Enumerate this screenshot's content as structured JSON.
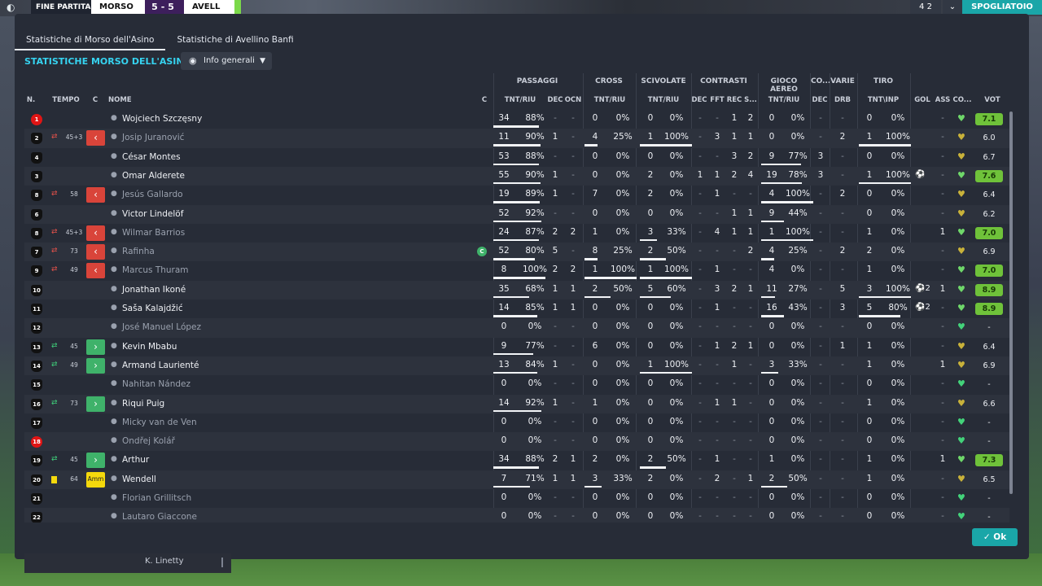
{
  "topbar": {
    "status": "FINE PARTITA",
    "team1": "MORSO",
    "score": "5-5",
    "team2": "AVELL",
    "count": "4 2",
    "dressing_room": "SPOGLIATOIO"
  },
  "tabs": [
    {
      "label": "Statistiche di Morso dell'Asino",
      "active": true
    },
    {
      "label": "Statistiche di Avellino Banfi",
      "active": false
    }
  ],
  "page_title": "STATISTICHE MORSO DELL'ASINO",
  "view_dropdown": {
    "value": "Info generali",
    "icon": "eye-icon"
  },
  "groups": [
    "PASSAGGI",
    "CROSS",
    "SCIVOLATE",
    "CONTRASTI",
    "GIOCO AEREO",
    "CO...",
    "VARIE",
    "TIRO"
  ],
  "headers": {
    "num": "N.",
    "tempo": "TEMPO",
    "c": "C",
    "nome": "NOME",
    "c2": "C",
    "pass_tnt": "TNT/RIU",
    "pass_dec": "DEC",
    "pass_ocn": "OCN",
    "cross_tnt": "TNT/RIU",
    "scivolate_tnt": "TNT/RIU",
    "contrasti_dec": "DEC",
    "contrasti_fft": "FFT",
    "contrasti_rec": "REC",
    "contrasti_s": "S...",
    "aereo_tnt": "TNT/RIU",
    "co_dec": "DEC",
    "varie_drb": "DRB",
    "tiro_tnt": "TNT\\INP",
    "gol": "GOL",
    "ass": "ASS",
    "co": "CO...",
    "vot": "VOT"
  },
  "players": [
    {
      "num": "1",
      "gk": true,
      "minute": "",
      "sub": "",
      "name": "Wojciech Szczęsny",
      "dim": false,
      "captain": false,
      "pt": "34",
      "pp": "88%",
      "pbar": 0.88,
      "pdec": "-",
      "pocn": "-",
      "ct": "0",
      "cp": "0%",
      "cbar": 0,
      "st": "0",
      "sp": "0%",
      "sbar": 0,
      "kdec": "-",
      "kfft": "-",
      "krec": "1",
      "ks": "2",
      "at": "0",
      "ap": "0%",
      "abar": 0,
      "codec": "-",
      "drb": "-",
      "tt": "0",
      "tp": "0%",
      "tbar": 0,
      "gol": "",
      "ass": "-",
      "vote": "7.1",
      "hi": true
    },
    {
      "num": "2",
      "gk": false,
      "minute": "45+3",
      "sub": "out",
      "name": "Josip Juranović",
      "dim": true,
      "captain": false,
      "pt": "11",
      "pp": "90%",
      "pbar": 0.9,
      "pdec": "1",
      "pocn": "-",
      "ct": "4",
      "cp": "25%",
      "cbar": 0.25,
      "st": "1",
      "sp": "100%",
      "sbar": 1,
      "kdec": "-",
      "kfft": "3",
      "krec": "1",
      "ks": "1",
      "at": "0",
      "ap": "0%",
      "abar": 0,
      "codec": "-",
      "drb": "2",
      "tt": "1",
      "tp": "100%",
      "tbar": 1,
      "gol": "",
      "ass": "-",
      "vote": "6.0",
      "hi": false
    },
    {
      "num": "4",
      "gk": false,
      "minute": "",
      "sub": "",
      "name": "César Montes",
      "dim": false,
      "captain": false,
      "pt": "53",
      "pp": "88%",
      "pbar": 0.88,
      "pdec": "-",
      "pocn": "-",
      "ct": "0",
      "cp": "0%",
      "cbar": 0,
      "st": "0",
      "sp": "0%",
      "sbar": 0,
      "kdec": "-",
      "kfft": "-",
      "krec": "3",
      "ks": "2",
      "at": "9",
      "ap": "77%",
      "abar": 0.77,
      "codec": "3",
      "drb": "-",
      "tt": "0",
      "tp": "0%",
      "tbar": 0,
      "gol": "",
      "ass": "-",
      "vote": "6.7",
      "hi": false
    },
    {
      "num": "3",
      "gk": false,
      "minute": "",
      "sub": "",
      "name": "Omar Alderete",
      "dim": false,
      "captain": false,
      "pt": "55",
      "pp": "90%",
      "pbar": 0.9,
      "pdec": "1",
      "pocn": "-",
      "ct": "0",
      "cp": "0%",
      "cbar": 0,
      "st": "2",
      "sp": "0%",
      "sbar": 0,
      "kdec": "1",
      "kfft": "1",
      "krec": "2",
      "ks": "4",
      "at": "19",
      "ap": "78%",
      "abar": 0.78,
      "codec": "3",
      "drb": "-",
      "tt": "1",
      "tp": "100%",
      "tbar": 1,
      "gol": "⚽",
      "ass": "-",
      "vote": "7.6",
      "hi": true
    },
    {
      "num": "8",
      "gk": false,
      "minute": "58",
      "sub": "out",
      "name": "Jesús Gallardo",
      "dim": true,
      "captain": false,
      "pt": "19",
      "pp": "89%",
      "pbar": 0.89,
      "pdec": "1",
      "pocn": "-",
      "ct": "7",
      "cp": "0%",
      "cbar": 0,
      "st": "2",
      "sp": "0%",
      "sbar": 0,
      "kdec": "-",
      "kfft": "1",
      "krec": "-",
      "ks": "-",
      "at": "4",
      "ap": "100%",
      "abar": 1,
      "codec": "-",
      "drb": "2",
      "tt": "0",
      "tp": "0%",
      "tbar": 0,
      "gol": "",
      "ass": "-",
      "vote": "6.4",
      "hi": false
    },
    {
      "num": "6",
      "gk": false,
      "minute": "",
      "sub": "",
      "name": "Victor Lindelöf",
      "dim": false,
      "captain": false,
      "pt": "52",
      "pp": "92%",
      "pbar": 0.92,
      "pdec": "-",
      "pocn": "-",
      "ct": "0",
      "cp": "0%",
      "cbar": 0,
      "st": "0",
      "sp": "0%",
      "sbar": 0,
      "kdec": "-",
      "kfft": "-",
      "krec": "1",
      "ks": "1",
      "at": "9",
      "ap": "44%",
      "abar": 0.44,
      "codec": "-",
      "drb": "-",
      "tt": "0",
      "tp": "0%",
      "tbar": 0,
      "gol": "",
      "ass": "-",
      "vote": "6.2",
      "hi": false
    },
    {
      "num": "8",
      "gk": false,
      "minute": "45+3",
      "sub": "out",
      "name": "Wilmar Barrios",
      "dim": true,
      "captain": false,
      "pt": "24",
      "pp": "87%",
      "pbar": 0.87,
      "pdec": "2",
      "pocn": "2",
      "ct": "1",
      "cp": "0%",
      "cbar": 0,
      "st": "3",
      "sp": "33%",
      "sbar": 0.33,
      "kdec": "-",
      "kfft": "4",
      "krec": "1",
      "ks": "1",
      "at": "1",
      "ap": "100%",
      "abar": 1,
      "codec": "-",
      "drb": "-",
      "tt": "1",
      "tp": "0%",
      "tbar": 0,
      "gol": "",
      "ass": "1",
      "vote": "7.0",
      "hi": true
    },
    {
      "num": "7",
      "gk": false,
      "minute": "73",
      "sub": "out",
      "name": "Rafinha",
      "dim": true,
      "captain": true,
      "pt": "52",
      "pp": "80%",
      "pbar": 0.8,
      "pdec": "5",
      "pocn": "-",
      "ct": "8",
      "cp": "25%",
      "cbar": 0.25,
      "st": "2",
      "sp": "50%",
      "sbar": 0.5,
      "kdec": "-",
      "kfft": "-",
      "krec": "-",
      "ks": "2",
      "at": "4",
      "ap": "25%",
      "abar": 0.25,
      "codec": "-",
      "drb": "2",
      "tt": "2",
      "tp": "0%",
      "tbar": 0,
      "gol": "",
      "ass": "-",
      "vote": "6.9",
      "hi": false
    },
    {
      "num": "9",
      "gk": false,
      "minute": "49",
      "sub": "out",
      "name": "Marcus Thuram",
      "dim": true,
      "captain": false,
      "pt": "8",
      "pp": "100%",
      "pbar": 1,
      "pdec": "2",
      "pocn": "2",
      "ct": "1",
      "cp": "100%",
      "cbar": 1,
      "st": "1",
      "sp": "100%",
      "sbar": 1,
      "kdec": "-",
      "kfft": "1",
      "krec": "-",
      "ks": "-",
      "at": "4",
      "ap": "0%",
      "abar": 0,
      "codec": "-",
      "drb": "-",
      "tt": "1",
      "tp": "0%",
      "tbar": 0,
      "gol": "",
      "ass": "-",
      "vote": "7.0",
      "hi": true
    },
    {
      "num": "10",
      "gk": false,
      "minute": "",
      "sub": "",
      "name": "Jonathan Ikoné",
      "dim": false,
      "captain": false,
      "pt": "35",
      "pp": "68%",
      "pbar": 0.68,
      "pdec": "1",
      "pocn": "1",
      "ct": "2",
      "cp": "50%",
      "cbar": 0.5,
      "st": "5",
      "sp": "60%",
      "sbar": 0.6,
      "kdec": "-",
      "kfft": "3",
      "krec": "2",
      "ks": "1",
      "at": "11",
      "ap": "27%",
      "abar": 0.27,
      "codec": "-",
      "drb": "5",
      "tt": "3",
      "tp": "100%",
      "tbar": 1,
      "gol": "⚽2",
      "ass": "1",
      "vote": "8.9",
      "hi": true
    },
    {
      "num": "11",
      "gk": false,
      "minute": "",
      "sub": "",
      "name": "Saša Kalajdžić",
      "dim": false,
      "captain": false,
      "pt": "14",
      "pp": "85%",
      "pbar": 0.85,
      "pdec": "1",
      "pocn": "1",
      "ct": "0",
      "cp": "0%",
      "cbar": 0,
      "st": "0",
      "sp": "0%",
      "sbar": 0,
      "kdec": "-",
      "kfft": "1",
      "krec": "-",
      "ks": "-",
      "at": "16",
      "ap": "43%",
      "abar": 0.43,
      "codec": "-",
      "drb": "3",
      "tt": "5",
      "tp": "80%",
      "tbar": 0.8,
      "gol": "⚽2",
      "ass": "-",
      "vote": "8.9",
      "hi": true
    },
    {
      "num": "12",
      "gk": false,
      "minute": "",
      "sub": "",
      "name": "José Manuel López",
      "dim": true,
      "captain": false,
      "pt": "0",
      "pp": "0%",
      "pbar": 0,
      "pdec": "-",
      "pocn": "-",
      "ct": "0",
      "cp": "0%",
      "cbar": 0,
      "st": "0",
      "sp": "0%",
      "sbar": 0,
      "kdec": "-",
      "kfft": "-",
      "krec": "-",
      "ks": "-",
      "at": "0",
      "ap": "0%",
      "abar": 0,
      "codec": "-",
      "drb": "-",
      "tt": "0",
      "tp": "0%",
      "tbar": 0,
      "gol": "",
      "ass": "-",
      "vote": "-",
      "hi": false
    },
    {
      "num": "13",
      "gk": false,
      "minute": "45",
      "sub": "in",
      "name": "Kevin Mbabu",
      "dim": false,
      "captain": false,
      "pt": "9",
      "pp": "77%",
      "pbar": 0.77,
      "pdec": "-",
      "pocn": "-",
      "ct": "6",
      "cp": "0%",
      "cbar": 0,
      "st": "0",
      "sp": "0%",
      "sbar": 0,
      "kdec": "-",
      "kfft": "1",
      "krec": "2",
      "ks": "1",
      "at": "0",
      "ap": "0%",
      "abar": 0,
      "codec": "-",
      "drb": "1",
      "tt": "1",
      "tp": "0%",
      "tbar": 0,
      "gol": "",
      "ass": "-",
      "vote": "6.4",
      "hi": false
    },
    {
      "num": "14",
      "gk": false,
      "minute": "49",
      "sub": "in",
      "name": "Armand Laurienté",
      "dim": false,
      "captain": false,
      "pt": "13",
      "pp": "84%",
      "pbar": 0.84,
      "pdec": "1",
      "pocn": "-",
      "ct": "0",
      "cp": "0%",
      "cbar": 0,
      "st": "1",
      "sp": "100%",
      "sbar": 1,
      "kdec": "-",
      "kfft": "-",
      "krec": "1",
      "ks": "-",
      "at": "3",
      "ap": "33%",
      "abar": 0.33,
      "codec": "-",
      "drb": "-",
      "tt": "1",
      "tp": "0%",
      "tbar": 0,
      "gol": "",
      "ass": "1",
      "vote": "6.9",
      "hi": false
    },
    {
      "num": "15",
      "gk": false,
      "minute": "",
      "sub": "",
      "name": "Nahitan Nández",
      "dim": true,
      "captain": false,
      "pt": "0",
      "pp": "0%",
      "pbar": 0,
      "pdec": "-",
      "pocn": "-",
      "ct": "0",
      "cp": "0%",
      "cbar": 0,
      "st": "0",
      "sp": "0%",
      "sbar": 0,
      "kdec": "-",
      "kfft": "-",
      "krec": "-",
      "ks": "-",
      "at": "0",
      "ap": "0%",
      "abar": 0,
      "codec": "-",
      "drb": "-",
      "tt": "0",
      "tp": "0%",
      "tbar": 0,
      "gol": "",
      "ass": "-",
      "vote": "-",
      "hi": false
    },
    {
      "num": "16",
      "gk": false,
      "minute": "73",
      "sub": "in",
      "name": "Riqui Puig",
      "dim": false,
      "captain": false,
      "pt": "14",
      "pp": "92%",
      "pbar": 0.92,
      "pdec": "1",
      "pocn": "-",
      "ct": "1",
      "cp": "0%",
      "cbar": 0,
      "st": "0",
      "sp": "0%",
      "sbar": 0,
      "kdec": "-",
      "kfft": "1",
      "krec": "1",
      "ks": "-",
      "at": "0",
      "ap": "0%",
      "abar": 0,
      "codec": "-",
      "drb": "-",
      "tt": "1",
      "tp": "0%",
      "tbar": 0,
      "gol": "",
      "ass": "-",
      "vote": "6.6",
      "hi": false
    },
    {
      "num": "17",
      "gk": false,
      "minute": "",
      "sub": "",
      "name": "Micky van de Ven",
      "dim": true,
      "captain": false,
      "pt": "0",
      "pp": "0%",
      "pbar": 0,
      "pdec": "-",
      "pocn": "-",
      "ct": "0",
      "cp": "0%",
      "cbar": 0,
      "st": "0",
      "sp": "0%",
      "sbar": 0,
      "kdec": "-",
      "kfft": "-",
      "krec": "-",
      "ks": "-",
      "at": "0",
      "ap": "0%",
      "abar": 0,
      "codec": "-",
      "drb": "-",
      "tt": "0",
      "tp": "0%",
      "tbar": 0,
      "gol": "",
      "ass": "-",
      "vote": "-",
      "hi": false
    },
    {
      "num": "18",
      "gk": true,
      "minute": "",
      "sub": "",
      "name": "Ondřej Kolář",
      "dim": true,
      "captain": false,
      "pt": "0",
      "pp": "0%",
      "pbar": 0,
      "pdec": "-",
      "pocn": "-",
      "ct": "0",
      "cp": "0%",
      "cbar": 0,
      "st": "0",
      "sp": "0%",
      "sbar": 0,
      "kdec": "-",
      "kfft": "-",
      "krec": "-",
      "ks": "-",
      "at": "0",
      "ap": "0%",
      "abar": 0,
      "codec": "-",
      "drb": "-",
      "tt": "0",
      "tp": "0%",
      "tbar": 0,
      "gol": "",
      "ass": "-",
      "vote": "-",
      "hi": false
    },
    {
      "num": "19",
      "gk": false,
      "minute": "45",
      "sub": "in",
      "name": "Arthur",
      "dim": false,
      "captain": false,
      "pt": "34",
      "pp": "88%",
      "pbar": 0.88,
      "pdec": "2",
      "pocn": "1",
      "ct": "2",
      "cp": "0%",
      "cbar": 0,
      "st": "2",
      "sp": "50%",
      "sbar": 0.5,
      "kdec": "-",
      "kfft": "1",
      "krec": "-",
      "ks": "-",
      "at": "1",
      "ap": "0%",
      "abar": 0,
      "codec": "-",
      "drb": "-",
      "tt": "1",
      "tp": "0%",
      "tbar": 0,
      "gol": "",
      "ass": "1",
      "vote": "7.3",
      "hi": true
    },
    {
      "num": "20",
      "gk": false,
      "minute": "64",
      "sub": "amm",
      "yellow": true,
      "name": "Wendell",
      "dim": false,
      "captain": false,
      "pt": "7",
      "pp": "71%",
      "pbar": 0.71,
      "pdec": "1",
      "pocn": "1",
      "ct": "3",
      "cp": "33%",
      "cbar": 0.33,
      "st": "2",
      "sp": "0%",
      "sbar": 0,
      "kdec": "-",
      "kfft": "2",
      "krec": "-",
      "ks": "1",
      "at": "2",
      "ap": "50%",
      "abar": 0.5,
      "codec": "-",
      "drb": "-",
      "tt": "1",
      "tp": "0%",
      "tbar": 0,
      "gol": "",
      "ass": "-",
      "vote": "6.5",
      "hi": false
    },
    {
      "num": "21",
      "gk": false,
      "minute": "",
      "sub": "",
      "name": "Florian Grillitsch",
      "dim": true,
      "captain": false,
      "pt": "0",
      "pp": "0%",
      "pbar": 0,
      "pdec": "-",
      "pocn": "-",
      "ct": "0",
      "cp": "0%",
      "cbar": 0,
      "st": "0",
      "sp": "0%",
      "sbar": 0,
      "kdec": "-",
      "kfft": "-",
      "krec": "-",
      "ks": "-",
      "at": "0",
      "ap": "0%",
      "abar": 0,
      "codec": "-",
      "drb": "-",
      "tt": "0",
      "tp": "0%",
      "tbar": 0,
      "gol": "",
      "ass": "-",
      "vote": "-",
      "hi": false
    },
    {
      "num": "22",
      "gk": false,
      "minute": "",
      "sub": "",
      "name": "Lautaro Giaccone",
      "dim": true,
      "captain": false,
      "pt": "0",
      "pp": "0%",
      "pbar": 0,
      "pdec": "-",
      "pocn": "-",
      "ct": "0",
      "cp": "0%",
      "cbar": 0,
      "st": "0",
      "sp": "0%",
      "sbar": 0,
      "kdec": "-",
      "kfft": "-",
      "krec": "-",
      "ks": "-",
      "at": "0",
      "ap": "0%",
      "abar": 0,
      "codec": "-",
      "drb": "-",
      "tt": "0",
      "tp": "0%",
      "tbar": 0,
      "gol": "",
      "ass": "-",
      "vote": "-",
      "hi": false
    }
  ],
  "ok_label": "✓ Ok",
  "bottom_player": "K. Linetty",
  "colors": {
    "accent": "#36d3f0",
    "ok": "#1aa6a8",
    "rating_hi": "#6fc23a",
    "sub_out": "#d9443a",
    "sub_in": "#3fb26a"
  }
}
